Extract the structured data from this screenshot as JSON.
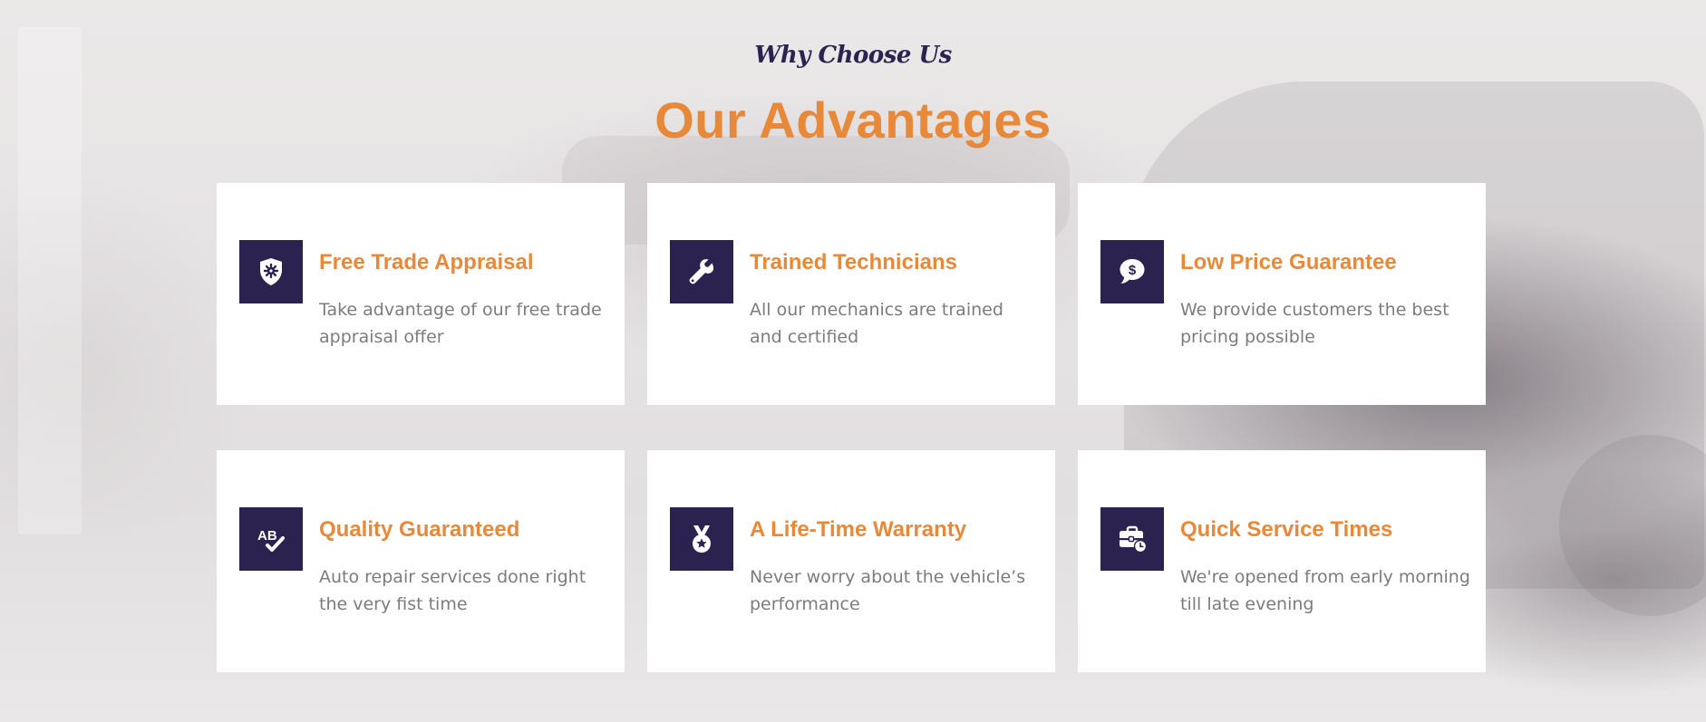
{
  "section": {
    "kicker": "Why Choose Us",
    "heading": "Our Advantages"
  },
  "colors": {
    "accent": "#e8893a",
    "icon_bg": "#2b2250",
    "kicker": "#2c2450",
    "body_text": "#7c7c7c"
  },
  "cards": [
    {
      "icon": "shield-gear-icon",
      "title": "Free Trade Appraisal",
      "description": "Take advantage of our free trade appraisal offer"
    },
    {
      "icon": "wrench-icon",
      "title": "Trained Technicians",
      "description": "All our mechanics are trained and certified"
    },
    {
      "icon": "dollar-chat-icon",
      "title": "Low Price Guarantee",
      "description": "We provide customers the best pricing possible"
    },
    {
      "icon": "spellcheck-icon",
      "title": "Quality Guaranteed",
      "description": "Auto repair services done right the very fist time"
    },
    {
      "icon": "medal-icon",
      "title": "A Life-Time Warranty",
      "description": "Never worry about the vehicle’s performance"
    },
    {
      "icon": "business-time-icon",
      "title": "Quick Service Times",
      "description": "We're opened from early morning till late evening"
    }
  ]
}
